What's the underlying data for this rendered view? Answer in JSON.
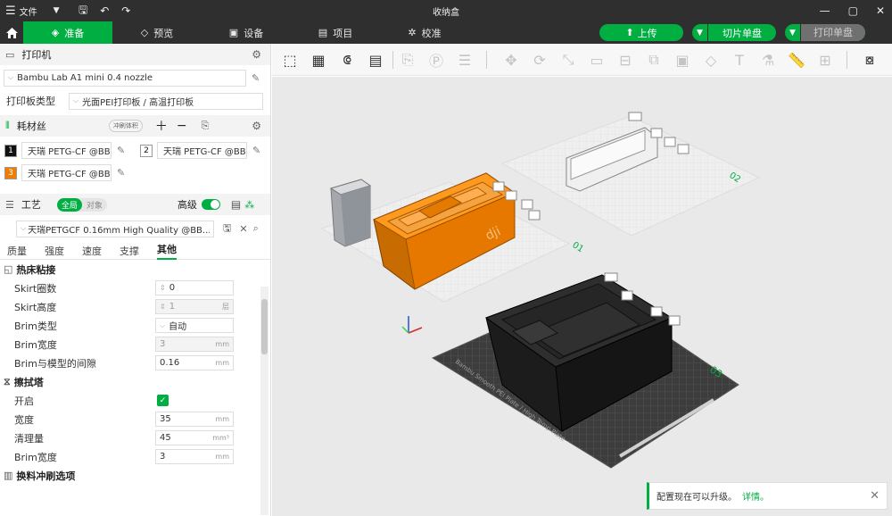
{
  "titlebar": {
    "file_label": "文件",
    "title": "收纳盒"
  },
  "tabs": [
    {
      "label": "准备"
    },
    {
      "label": "预览"
    },
    {
      "label": "设备"
    },
    {
      "label": "项目"
    },
    {
      "label": "校准"
    }
  ],
  "actions": {
    "upload": "上传",
    "slice": "切片单盘",
    "print": "打印单盘"
  },
  "printer": {
    "section": "打印机",
    "name": "Bambu Lab A1 mini 0.4 nozzle",
    "plate_type_label": "打印板类型",
    "plate_type": "光面PEI打印板 / 高温打印板"
  },
  "filament": {
    "section": "耗材丝",
    "flush_tag": "冲刷体积",
    "items": [
      {
        "num": "1",
        "name": "天瑞 PETG-CF @BB...",
        "color": "#111111",
        "text": "#ffffff"
      },
      {
        "num": "2",
        "name": "天瑞 PETG-CF @BB...",
        "color": "#ffffff",
        "text": "#111111"
      },
      {
        "num": "3",
        "name": "天瑞 PETG-CF @BB...",
        "color": "#f07c00",
        "text": "#ffffff"
      }
    ]
  },
  "process": {
    "section": "工艺",
    "global": "全局",
    "object": "对象",
    "advanced": "高级",
    "preset": "天瑞PETGCF 0.16mm High Quality @BB...",
    "subtabs": [
      "质量",
      "强度",
      "速度",
      "支撑",
      "其他"
    ],
    "groups": [
      {
        "title": "热床粘接",
        "rows": [
          {
            "label": "Skirt圈数",
            "value": "0",
            "unit": "",
            "spin": true
          },
          {
            "label": "Skirt高度",
            "value": "1",
            "unit": "层",
            "spin": true,
            "disabled": true
          },
          {
            "label": "Brim类型",
            "value": "自动",
            "unit": "",
            "dropdown": true
          },
          {
            "label": "Brim宽度",
            "value": "3",
            "unit": "mm",
            "disabled": true
          },
          {
            "label": "Brim与模型的间隙",
            "value": "0.16",
            "unit": "mm"
          }
        ]
      },
      {
        "title": "擦拭塔",
        "rows": [
          {
            "label": "开启",
            "checkbox": true
          },
          {
            "label": "宽度",
            "value": "35",
            "unit": "mm"
          },
          {
            "label": "清理量",
            "value": "45",
            "unit": "mm³"
          },
          {
            "label": "Brim宽度",
            "value": "3",
            "unit": "mm"
          }
        ]
      },
      {
        "title": "换料冲刷选项",
        "rows": []
      }
    ]
  },
  "plates": [
    {
      "label": "01"
    },
    {
      "label": "02"
    },
    {
      "label": "03"
    }
  ],
  "plate_text": "Bambu Smooth PEI Plate / High Temp Plate",
  "toast": {
    "text": "配置现在可以升级。",
    "link": "详情。"
  },
  "colors": {
    "accent": "#00ae42",
    "orange": "#f07c00",
    "dark": "#2f2f2f"
  }
}
